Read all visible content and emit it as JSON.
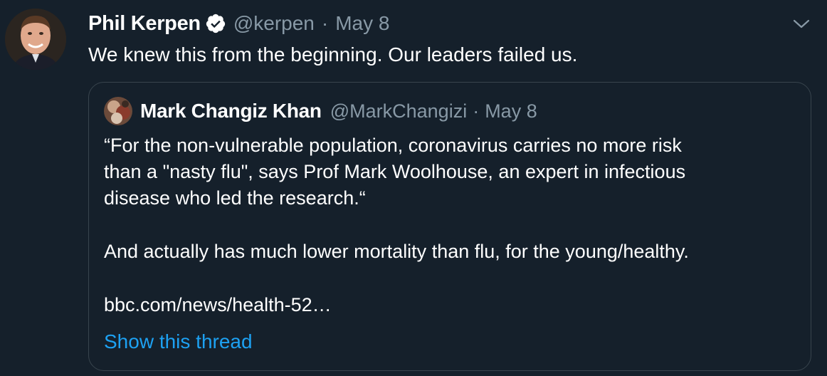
{
  "tweet": {
    "author_name": "Phil Kerpen",
    "author_handle": "@kerpen",
    "separator": "·",
    "date": "May 8",
    "text": "We knew this from the beginning. Our leaders failed us.",
    "verified": true
  },
  "quoted_tweet": {
    "author_name": "Mark Changiz Khan",
    "author_handle": "@MarkChangizi",
    "separator": "·",
    "date": "May 8",
    "paragraphs": [
      "“For the non-vulnerable population, coronavirus carries no more risk",
      "than a \"nasty flu\", says Prof Mark Woolhouse, an expert in infectious",
      "disease who led the research.“"
    ],
    "paragraph2": "And actually has much lower mortality than flu, for the young/healthy.",
    "link_text": "bbc.com/news/health-52…",
    "show_thread_label": "Show this thread"
  },
  "colors": {
    "background": "#15202b",
    "text_primary": "#ffffff",
    "text_secondary": "#8899a6",
    "link": "#1da1f2",
    "border": "#38444d",
    "verified": "#ffffff"
  },
  "icons": {
    "verified": "verified-badge-icon",
    "menu": "chevron-down-icon"
  }
}
